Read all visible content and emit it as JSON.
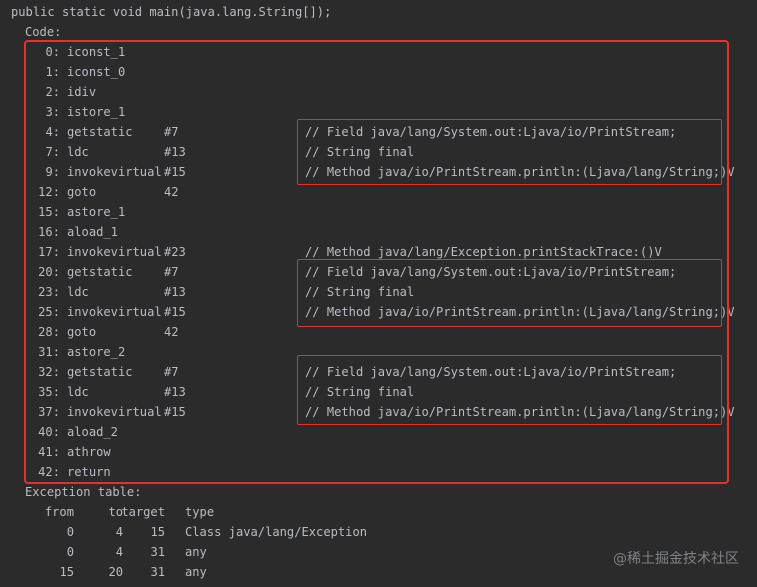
{
  "signature": "public static void main(java.lang.String[]);",
  "code_label": "Code:",
  "instructions": [
    {
      "offset": "0:",
      "op": "iconst_1",
      "arg": "",
      "comment": ""
    },
    {
      "offset": "1:",
      "op": "iconst_0",
      "arg": "",
      "comment": ""
    },
    {
      "offset": "2:",
      "op": "idiv",
      "arg": "",
      "comment": ""
    },
    {
      "offset": "3:",
      "op": "istore_1",
      "arg": "",
      "comment": ""
    },
    {
      "offset": "4:",
      "op": "getstatic",
      "arg": "#7",
      "comment": "// Field java/lang/System.out:Ljava/io/PrintStream;"
    },
    {
      "offset": "7:",
      "op": "ldc",
      "arg": "#13",
      "comment": "// String final"
    },
    {
      "offset": "9:",
      "op": "invokevirtual",
      "arg": "#15",
      "comment": "// Method java/io/PrintStream.println:(Ljava/lang/String;)V"
    },
    {
      "offset": "12:",
      "op": "goto",
      "arg": "42",
      "comment": ""
    },
    {
      "offset": "15:",
      "op": "astore_1",
      "arg": "",
      "comment": ""
    },
    {
      "offset": "16:",
      "op": "aload_1",
      "arg": "",
      "comment": ""
    },
    {
      "offset": "17:",
      "op": "invokevirtual",
      "arg": "#23",
      "comment": "// Method java/lang/Exception.printStackTrace:()V"
    },
    {
      "offset": "20:",
      "op": "getstatic",
      "arg": "#7",
      "comment": "// Field java/lang/System.out:Ljava/io/PrintStream;"
    },
    {
      "offset": "23:",
      "op": "ldc",
      "arg": "#13",
      "comment": "// String final"
    },
    {
      "offset": "25:",
      "op": "invokevirtual",
      "arg": "#15",
      "comment": "// Method java/io/PrintStream.println:(Ljava/lang/String;)V"
    },
    {
      "offset": "28:",
      "op": "goto",
      "arg": "42",
      "comment": ""
    },
    {
      "offset": "31:",
      "op": "astore_2",
      "arg": "",
      "comment": ""
    },
    {
      "offset": "32:",
      "op": "getstatic",
      "arg": "#7",
      "comment": "// Field java/lang/System.out:Ljava/io/PrintStream;"
    },
    {
      "offset": "35:",
      "op": "ldc",
      "arg": "#13",
      "comment": "// String final"
    },
    {
      "offset": "37:",
      "op": "invokevirtual",
      "arg": "#15",
      "comment": "// Method java/io/PrintStream.println:(Ljava/lang/String;)V"
    },
    {
      "offset": "40:",
      "op": "aload_2",
      "arg": "",
      "comment": ""
    },
    {
      "offset": "41:",
      "op": "athrow",
      "arg": "",
      "comment": ""
    },
    {
      "offset": "42:",
      "op": "return",
      "arg": "",
      "comment": ""
    }
  ],
  "exception_table": {
    "label": "Exception table:",
    "headers": [
      "from",
      "to",
      "target",
      "type"
    ],
    "rows": [
      [
        "0",
        "4",
        "15",
        "Class java/lang/Exception"
      ],
      [
        "0",
        "4",
        "31",
        "any"
      ],
      [
        "15",
        "20",
        "31",
        "any"
      ]
    ]
  },
  "watermark": "@稀土掘金技术社区",
  "colors": {
    "background": "#2b2b2b",
    "text": "#b8bcc4",
    "highlight": "#e0332d"
  }
}
